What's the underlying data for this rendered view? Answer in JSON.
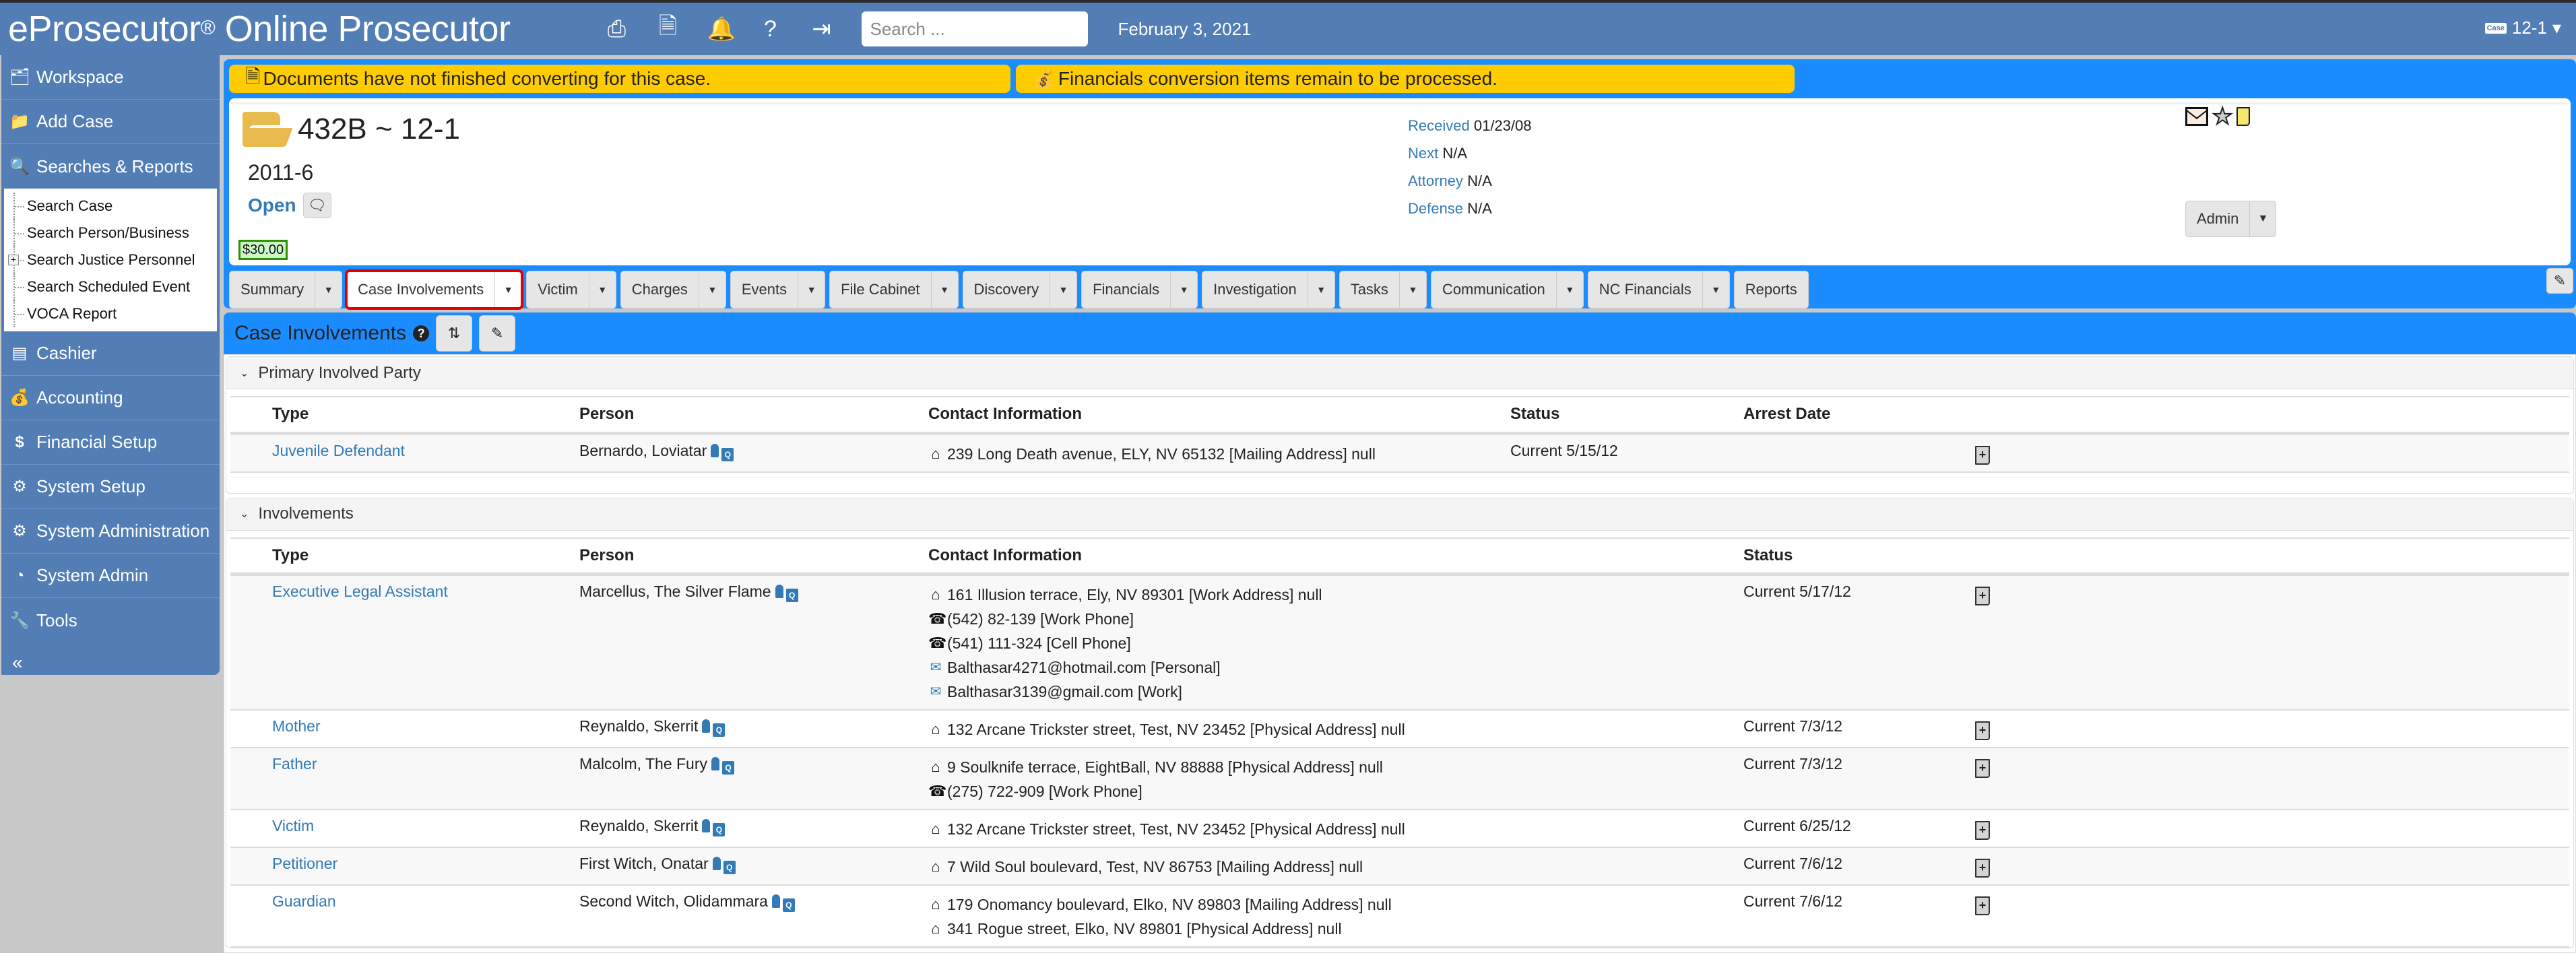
{
  "header": {
    "brand": "eProsecutor",
    "brand_mark": "®",
    "brand_suffix": " Online Prosecutor",
    "icons": [
      "print-icon",
      "document-icon",
      "bell-icon",
      "help-icon",
      "logout-icon"
    ],
    "search_placeholder": "Search ...",
    "date": "February 3, 2021",
    "case_picker": {
      "badge": "Case",
      "label": "12-1"
    }
  },
  "sidebar": {
    "items": [
      {
        "label": "Workspace",
        "icon": "folders-icon"
      },
      {
        "label": "Add Case",
        "icon": "add-folder-icon"
      },
      {
        "label": "Searches & Reports",
        "icon": "search-icon"
      },
      {
        "label": "Cashier",
        "icon": "cash-register-icon"
      },
      {
        "label": "Accounting",
        "icon": "money-bag-icon"
      },
      {
        "label": "Financial Setup",
        "icon": "dollar-icon"
      },
      {
        "label": "System Setup",
        "icon": "gears-icon"
      },
      {
        "label": "System Administration",
        "icon": "gears-icon"
      },
      {
        "label": "System Admin",
        "icon": "dashboard-icon"
      },
      {
        "label": "Tools",
        "icon": "wrench-icon"
      }
    ],
    "search_submenu": [
      {
        "label": "Search Case"
      },
      {
        "label": "Search Person/Business"
      },
      {
        "label": "Search Justice Personnel",
        "expandable": true
      },
      {
        "label": "Search Scheduled Event"
      },
      {
        "label": "VOCA Report"
      }
    ]
  },
  "alerts": [
    "Documents have not finished converting for this case.",
    "Financials conversion items remain to be processed."
  ],
  "case": {
    "number": "432B ~ 12-1",
    "year": "2011-6",
    "status": "Open",
    "balance": "$30.00",
    "meta": [
      {
        "label": "Received",
        "value": "01/23/08"
      },
      {
        "label": "Next",
        "value": "N/A"
      },
      {
        "label": "Attorney",
        "value": "N/A"
      },
      {
        "label": "Defense",
        "value": "N/A"
      }
    ],
    "admin_label": "Admin"
  },
  "tabs": [
    {
      "label": "Summary",
      "dropdown": true
    },
    {
      "label": "Case Involvements",
      "dropdown": true,
      "active": true
    },
    {
      "label": "Victim",
      "dropdown": true
    },
    {
      "label": "Charges",
      "dropdown": true
    },
    {
      "label": "Events",
      "dropdown": true
    },
    {
      "label": "File Cabinet",
      "dropdown": true
    },
    {
      "label": "Discovery",
      "dropdown": true
    },
    {
      "label": "Financials",
      "dropdown": true
    },
    {
      "label": "Investigation",
      "dropdown": true
    },
    {
      "label": "Tasks",
      "dropdown": true
    },
    {
      "label": "Communication",
      "dropdown": true
    },
    {
      "label": "NC Financials",
      "dropdown": true
    },
    {
      "label": "Reports",
      "dropdown": false
    }
  ],
  "section": {
    "title": "Case Involvements"
  },
  "primary": {
    "heading": "Primary Involved Party",
    "columns": [
      "Type",
      "Person",
      "Contact Information",
      "Status",
      "Arrest Date"
    ],
    "rows": [
      {
        "type": "Juvenile Defendant",
        "person": "Bernardo, Loviatar",
        "contacts": [
          {
            "kind": "home",
            "text": "239 Long Death avenue, ELY, NV 65132 [Mailing Address] null"
          }
        ],
        "status": "Current 5/15/12",
        "arrest_date": ""
      }
    ]
  },
  "involvements": {
    "heading": "Involvements",
    "columns": [
      "Type",
      "Person",
      "Contact Information",
      "",
      "Status"
    ],
    "rows": [
      {
        "type": "Executive Legal Assistant",
        "person": "Marcellus, The Silver Flame",
        "contacts": [
          {
            "kind": "home",
            "text": "161 Illusion terrace, Ely, NV 89301 [Work Address] null"
          },
          {
            "kind": "phone",
            "text": "(542) 82-139 [Work Phone]"
          },
          {
            "kind": "phone",
            "text": "(541) 111-324 [Cell Phone]"
          },
          {
            "kind": "email",
            "text": "Balthasar4271@hotmail.com [Personal]"
          },
          {
            "kind": "email",
            "text": "Balthasar3139@gmail.com [Work]"
          }
        ],
        "status": "Current 5/17/12"
      },
      {
        "type": "Mother",
        "person": "Reynaldo, Skerrit",
        "contacts": [
          {
            "kind": "home",
            "text": "132 Arcane Trickster street, Test, NV 23452 [Physical Address] null"
          }
        ],
        "status": "Current 7/3/12"
      },
      {
        "type": "Father",
        "person": "Malcolm, The Fury",
        "contacts": [
          {
            "kind": "home",
            "text": "9 Soulknife terrace, EightBall, NV 88888 [Physical Address] null"
          },
          {
            "kind": "phone",
            "text": "(275) 722-909 [Work Phone]"
          }
        ],
        "status": "Current 7/3/12"
      },
      {
        "type": "Victim",
        "person": "Reynaldo, Skerrit",
        "contacts": [
          {
            "kind": "home",
            "text": "132 Arcane Trickster street, Test, NV 23452 [Physical Address] null"
          }
        ],
        "status": "Current 6/25/12"
      },
      {
        "type": "Petitioner",
        "person": "First Witch, Onatar",
        "contacts": [
          {
            "kind": "home",
            "text": "7 Wild Soul boulevard, Test, NV 86753 [Mailing Address] null"
          }
        ],
        "status": "Current 7/6/12"
      },
      {
        "type": "Guardian",
        "person": "Second Witch, Olidammara",
        "contacts": [
          {
            "kind": "home",
            "text": "179 Onomancy boulevard, Elko, NV 89803 [Mailing Address] null"
          },
          {
            "kind": "home",
            "text": "341 Rogue street, Elko, NV 89801 [Physical Address] null"
          }
        ],
        "status": "Current 7/6/12"
      }
    ]
  },
  "colors": {
    "header_bg": "#527db5",
    "panel_bg": "#1b8cff",
    "alert_bg": "#ffcc00",
    "link": "#337ab7",
    "active_tab_outline": "#e50000",
    "balance_border": "#2f9200",
    "balance_bg": "#caf7c4"
  }
}
